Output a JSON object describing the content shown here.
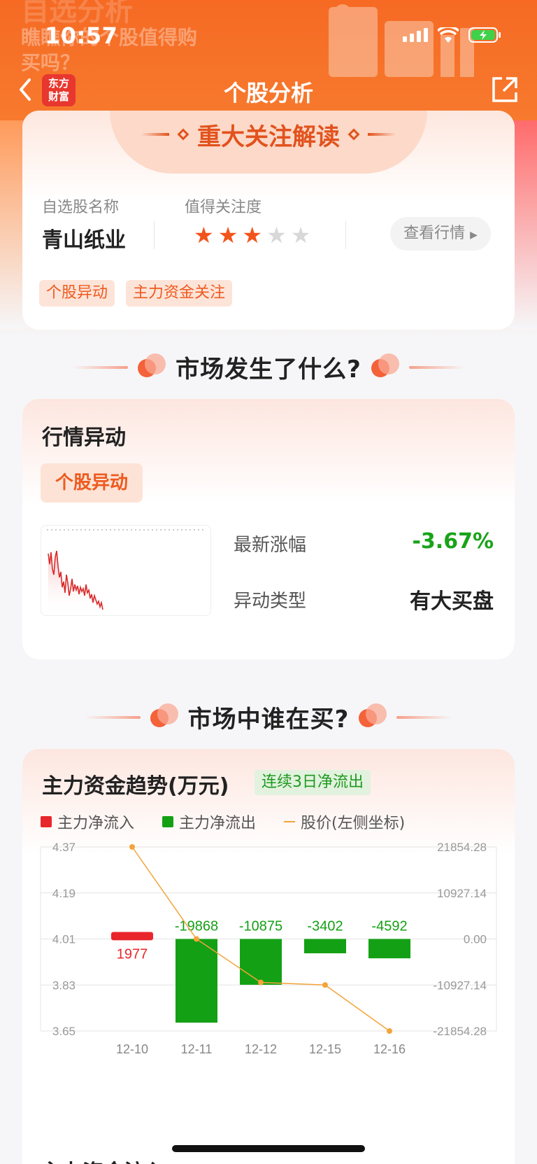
{
  "status_bar": {
    "time": "10:57"
  },
  "promo": {
    "line1": "自选分析",
    "line2": "瞧瞧你的个股值得购",
    "line3": "买吗？"
  },
  "nav": {
    "logo_line1": "东方",
    "logo_line2": "财富",
    "title": "个股分析"
  },
  "focus_card": {
    "title": "重大关注解读",
    "name_label": "自选股名称",
    "attention_label": "值得关注度",
    "stock_name": "青山纸业",
    "stars": {
      "filled": 3,
      "total": 5,
      "filled_color": "#f2541b",
      "empty_color": "#d8d8d8"
    },
    "quote_button": "查看行情",
    "tags": [
      "个股异动",
      "主力资金关注"
    ]
  },
  "section1": {
    "title": "市场发生了什么?"
  },
  "movement_card": {
    "title": "行情异动",
    "tag": "个股异动",
    "rows": [
      {
        "label": "最新涨幅",
        "value": "-3.67%",
        "color": "#19a319"
      },
      {
        "label": "异动类型",
        "value": "有大买盘",
        "color": "#222222"
      }
    ]
  },
  "section2": {
    "title": "市场中谁在买?"
  },
  "funds_card": {
    "title": "主力资金趋势(万元)",
    "badge": "连续3日净流出",
    "legend": [
      {
        "label": "主力净流入",
        "color": "#e8262b"
      },
      {
        "label": "主力净流出",
        "color": "#14a014"
      },
      {
        "label": "股价(左侧坐标)",
        "color": "#f3a43a"
      }
    ]
  },
  "chart_data": {
    "type": "bar",
    "categories": [
      "12-10",
      "12-11",
      "12-12",
      "12-15",
      "12-16"
    ],
    "series": [
      {
        "name": "主力净流入/流出",
        "values": [
          1977,
          -19868,
          -10875,
          -3402,
          -4592
        ]
      },
      {
        "name": "股价(左侧坐标)",
        "values": [
          4.37,
          4.01,
          3.84,
          3.83,
          3.65
        ]
      }
    ],
    "left_ticks": [
      "4.37",
      "4.19",
      "4.01",
      "3.83",
      "3.65"
    ],
    "right_ticks": [
      "21854.28",
      "10927.14",
      "0.00",
      "-10927.14",
      "-21854.28"
    ],
    "bar_labels": [
      "1977",
      "-19868",
      "-10875",
      "-3402",
      "-4592"
    ],
    "left_range": [
      3.65,
      4.37
    ],
    "right_range": [
      -21854.28,
      21854.28
    ],
    "grid": true,
    "positive_color": "#e8262b",
    "negative_color": "#14a014",
    "line_color": "#f3a43a"
  },
  "bottom": {
    "peek_title": "主力资金流入"
  }
}
